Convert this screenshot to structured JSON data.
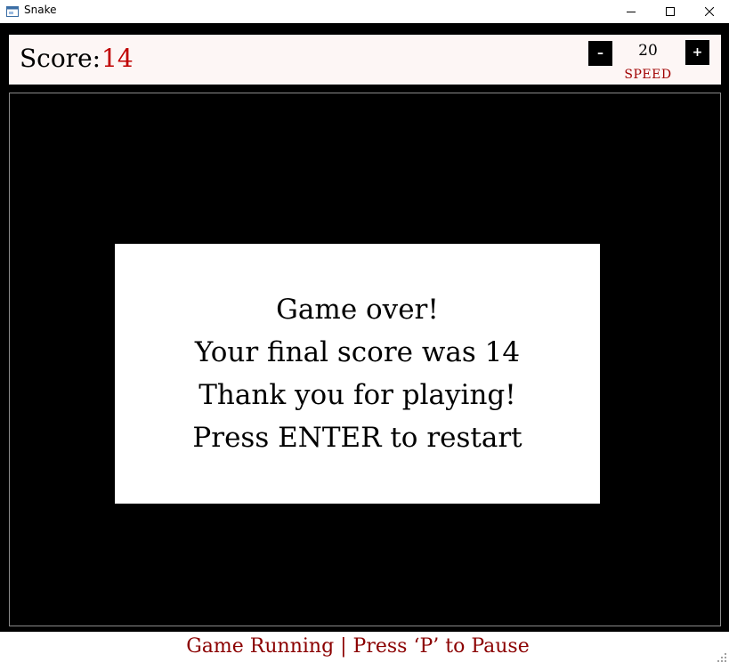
{
  "window": {
    "title": "Snake"
  },
  "score": {
    "label": "Score:",
    "value": "14"
  },
  "speed": {
    "minus_label": "–",
    "value": "20",
    "plus_label": "+",
    "label": "SPEED"
  },
  "game_over": {
    "lines": [
      "Game over!",
      "Your final score was 14",
      "Thank you for playing!",
      "Press ENTER to restart"
    ]
  },
  "status": {
    "text": "Game Running | Press ‘P’ to Pause"
  },
  "colors": {
    "board_background": "#000000",
    "score_value": "#c00000",
    "speed_label": "#a00000",
    "status_text": "#8b0000",
    "panel_background": "#fdf6f5"
  },
  "icons": {
    "app": "snake-app-icon",
    "minimize": "minimize-icon",
    "maximize": "maximize-icon",
    "close": "close-icon",
    "grip": "resize-grip-icon"
  }
}
